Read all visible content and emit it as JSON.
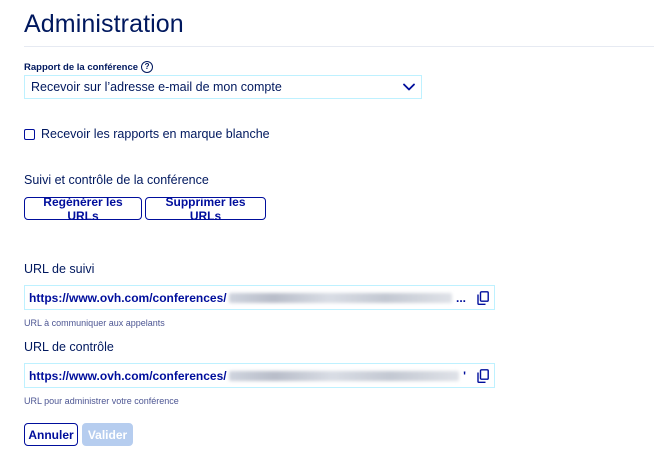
{
  "page": {
    "title": "Administration"
  },
  "report": {
    "label": "Rapport de la conférence",
    "help_icon": "?",
    "selected": "Recevoir sur l’adresse e-mail de mon compte"
  },
  "whitelabel": {
    "label": "Recevoir les rapports en marque blanche",
    "checked": false
  },
  "monitoring": {
    "section_label": "Suivi et contrôle de la conférence",
    "regen_label": "Regénérer les URLs",
    "delete_label": "Supprimer les URLs"
  },
  "tracking_url": {
    "label": "URL de suivi",
    "value": "https://www.ovh.com/conferences/",
    "ellipsis": "...",
    "helper": "URL à communiquer aux appelants"
  },
  "control_url": {
    "label": "URL de contrôle",
    "value": "https://www.ovh.com/conferences/",
    "ellipsis": "'",
    "helper": "URL pour administrer votre conférence"
  },
  "actions": {
    "cancel_label": "Annuler",
    "submit_label": "Valider"
  },
  "colors": {
    "primary": "#000e9c",
    "text": "#00185e",
    "field_border": "#bef1ff",
    "disabled": "#b6cdef"
  }
}
